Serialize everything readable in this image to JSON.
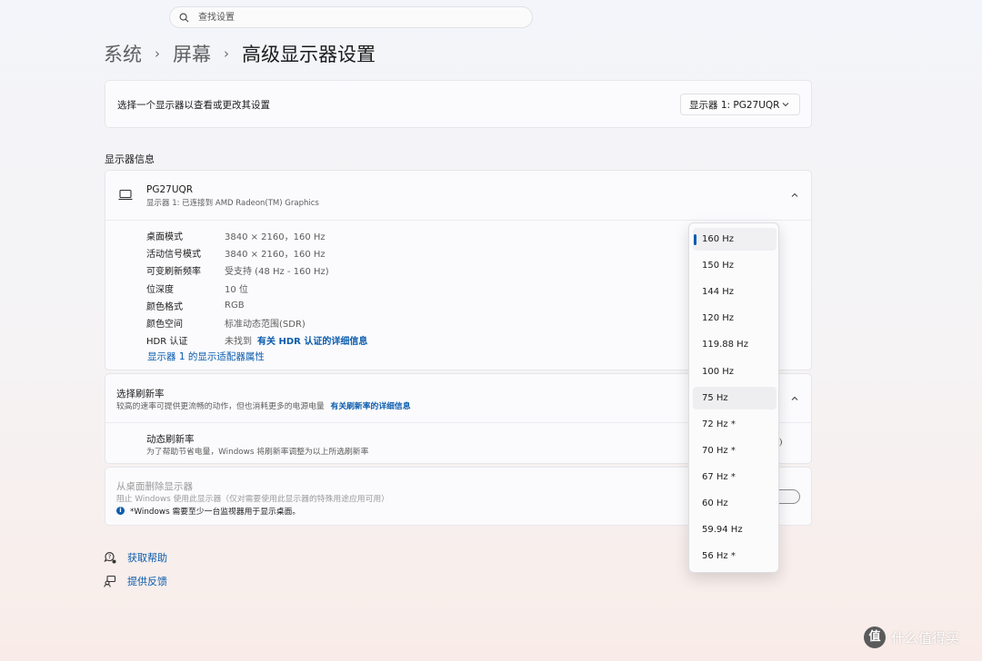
{
  "search": {
    "placeholder": "查找设置"
  },
  "breadcrumb": [
    "系统",
    "屏幕",
    "高级显示器设置"
  ],
  "select_display": {
    "label": "选择一个显示器以查看或更改其设置",
    "selected": "显示器 1: PG27UQR"
  },
  "display_info": {
    "section_title": "显示器信息",
    "name": "PG27UQR",
    "subtitle": "显示器 1: 已连接到 AMD Radeon(TM) Graphics",
    "rows": [
      {
        "key": "桌面模式",
        "value": "3840 × 2160，160 Hz"
      },
      {
        "key": "活动信号模式",
        "value": "3840 × 2160，160 Hz"
      },
      {
        "key": "可变刷新频率",
        "value": "受支持 (48 Hz - 160 Hz)"
      },
      {
        "key": "位深度",
        "value": "10 位"
      },
      {
        "key": "颜色格式",
        "value": "RGB"
      },
      {
        "key": "颜色空间",
        "value": "标准动态范围(SDR)"
      }
    ],
    "hdr_key": "HDR 认证",
    "hdr_value": "未找到",
    "hdr_link": "有关 HDR 认证的详细信息",
    "adapter_link": "显示器 1 的显示适配器属性"
  },
  "refresh": {
    "title": "选择刷新率",
    "desc": "较高的速率可提供更流畅的动作，但也消耗更多的电源电量",
    "link": "有关刷新率的详细信息",
    "dynamic_title": "动态刷新率",
    "dynamic_desc": "为了帮助节省电量，Windows 将刷新率调整为以上所选刷新率"
  },
  "remove_display": {
    "title": "从桌面删除显示器",
    "desc": "阻止 Windows 使用此显示器（仅对需要使用此显示器的特殊用途应用可用）",
    "note": "*Windows 需要至少一台监视器用于显示桌面。",
    "toggle_on": false
  },
  "help_links": [
    "获取帮助",
    "提供反馈"
  ],
  "refresh_options": {
    "selected": "160 Hz",
    "hovered": "75 Hz",
    "items": [
      "160 Hz",
      "150 Hz",
      "144 Hz",
      "120 Hz",
      "119.88 Hz",
      "100 Hz",
      "75 Hz",
      "72 Hz *",
      "70 Hz *",
      "67 Hz *",
      "60 Hz",
      "59.94 Hz",
      "56 Hz *"
    ]
  },
  "watermark": {
    "logo": "值",
    "text": "什么值得买"
  },
  "colors": {
    "accent": "#0b5cad",
    "text": "#1b1b1b",
    "secondary_text": "#5c5c5c"
  }
}
